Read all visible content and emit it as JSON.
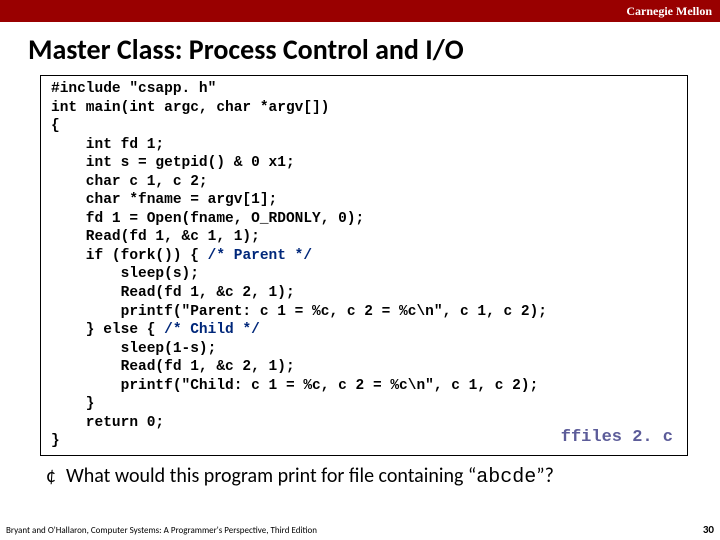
{
  "header": {
    "brand": "Carnegie Mellon"
  },
  "title": "Master Class: Process Control and I/O",
  "code": {
    "l1": "#include \"csapp. h\"",
    "l2": "int main(int argc, char *argv[])",
    "l3": "{",
    "l4": "    int fd 1;",
    "l5": "    int s = getpid() & 0 x1;",
    "l6": "    char c 1, c 2;",
    "l7": "    char *fname = argv[1];",
    "l8": "    fd 1 = Open(fname, O_RDONLY, 0);",
    "l9": "    Read(fd 1, &c 1, 1);",
    "l10a": "    if (fork()) { ",
    "l10b": "/* Parent */",
    "l11": "        sleep(s);",
    "l12": "        Read(fd 1, &c 2, 1);",
    "l13": "        printf(\"Parent: c 1 = %c, c 2 = %c\\n\", c 1, c 2);",
    "l14a": "    } else { ",
    "l14b": "/* Child */",
    "l15": "        sleep(1-s);",
    "l16": "        Read(fd 1, &c 2, 1);",
    "l17": "        printf(\"Child: c 1 = %c, c 2 = %c\\n\", c 1, c 2);",
    "l18": "    }",
    "l19": "    return 0;",
    "l20": "}"
  },
  "filename": "ffiles 2. c",
  "bullet": {
    "prefix": "What would this program print for file containing “",
    "mono": "abcde",
    "suffix": "”?"
  },
  "footer": {
    "left": "Bryant and O'Hallaron, Computer Systems: A Programmer's Perspective, Third Edition",
    "page": "30"
  }
}
